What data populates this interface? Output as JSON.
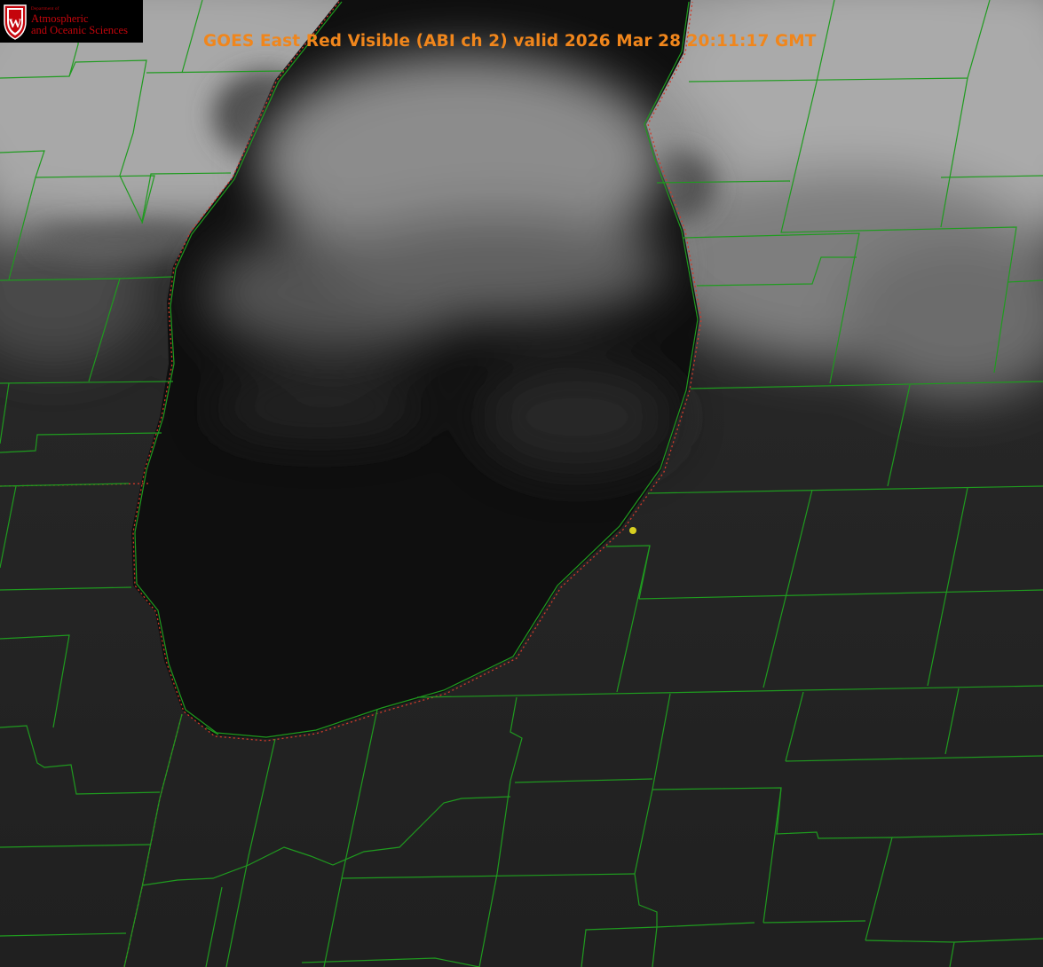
{
  "title": "GOES East Red Visible (ABI ch 2) valid 2026 Mar 28 20:11:17 GMT",
  "logo": {
    "department": "Department of",
    "line1": "Atmospheric",
    "line2": "and Oceanic Sciences",
    "seal_letter": "W"
  },
  "colors": {
    "title": "#f0861c",
    "county_lines": "#1f9b1f",
    "state_lines": "#d03a2a",
    "marker": "#d8d020",
    "logo_red": "#c5050c"
  },
  "map": {
    "product": "visible satellite imagery",
    "features": [
      "lake",
      "cloud-cover",
      "county-boundaries",
      "state-boundaries",
      "station-marker"
    ]
  }
}
